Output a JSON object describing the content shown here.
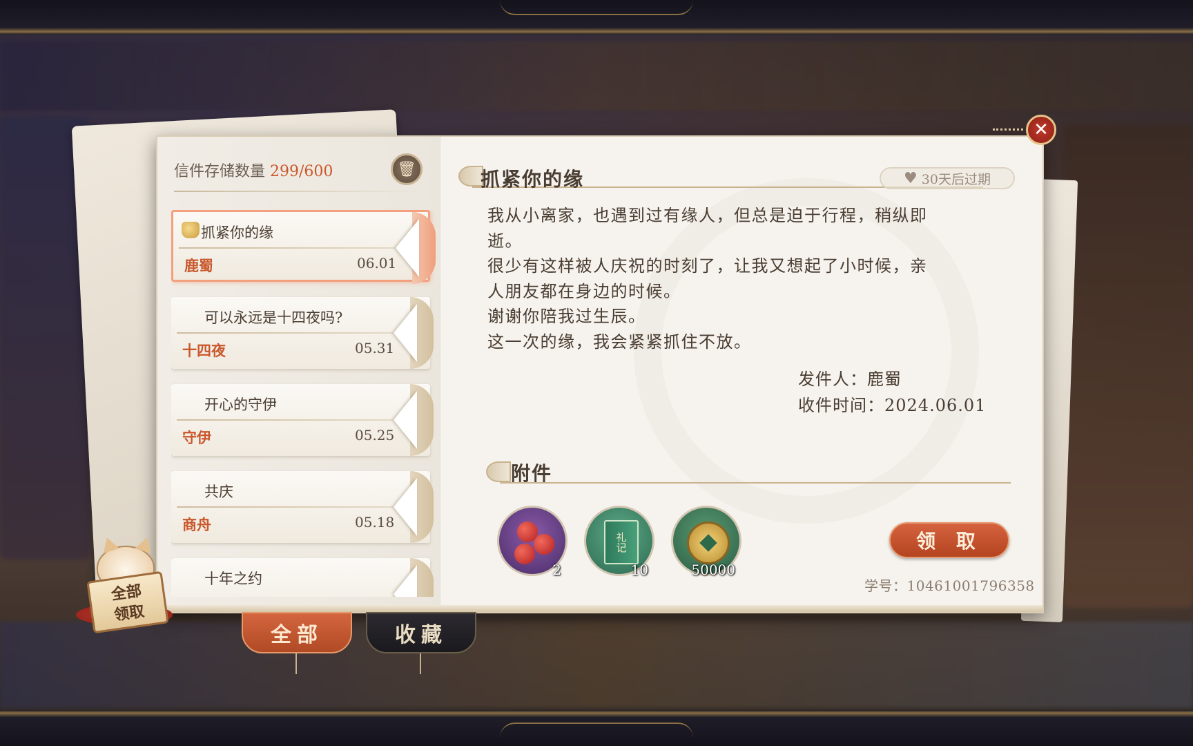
{
  "storage": {
    "label": "信件存储数量",
    "count": "299/600"
  },
  "mails": [
    {
      "subject": "抓紧你的缘",
      "sender": "鹿蜀",
      "date": "06.01",
      "active": true
    },
    {
      "subject": "可以永远是十四夜吗?",
      "sender": "十四夜",
      "date": "05.31",
      "active": false
    },
    {
      "subject": "开心的守伊",
      "sender": "守伊",
      "date": "05.25",
      "active": false
    },
    {
      "subject": "共庆",
      "sender": "商舟",
      "date": "05.18",
      "active": false
    },
    {
      "subject": "十年之约",
      "sender": "",
      "date": "",
      "active": false
    }
  ],
  "letter": {
    "title": "抓紧你的缘",
    "expire": "30天后过期",
    "body": [
      "我从小离家，也遇到过有缘人，但总是迫于行程，稍纵即",
      "逝。",
      "很少有这样被人庆祝的时刻了，让我又想起了小时候，亲",
      "人朋友都在身边的时候。",
      "谢谢你陪我过生辰。",
      "这一次的缘，我会紧紧抓住不放。"
    ],
    "sender_line": "发件人：鹿蜀",
    "time_line": "收件时间：2024.06.01"
  },
  "attachments": {
    "title": "附件",
    "items": [
      {
        "icon": "apples-icon",
        "count": "2"
      },
      {
        "icon": "etiquette-book-icon",
        "label": "礼记",
        "count": "10"
      },
      {
        "icon": "coin-icon",
        "count": "50000"
      }
    ]
  },
  "claim_button": "领 取",
  "student_id": "学号：10461001796358",
  "tabs": {
    "all": "全部",
    "favorites": "收藏"
  },
  "claim_all": {
    "line1": "全部",
    "line2": "领取"
  },
  "colors": {
    "accent": "#c9582c",
    "panel": "#f6f3ee",
    "close": "#c0392b"
  }
}
